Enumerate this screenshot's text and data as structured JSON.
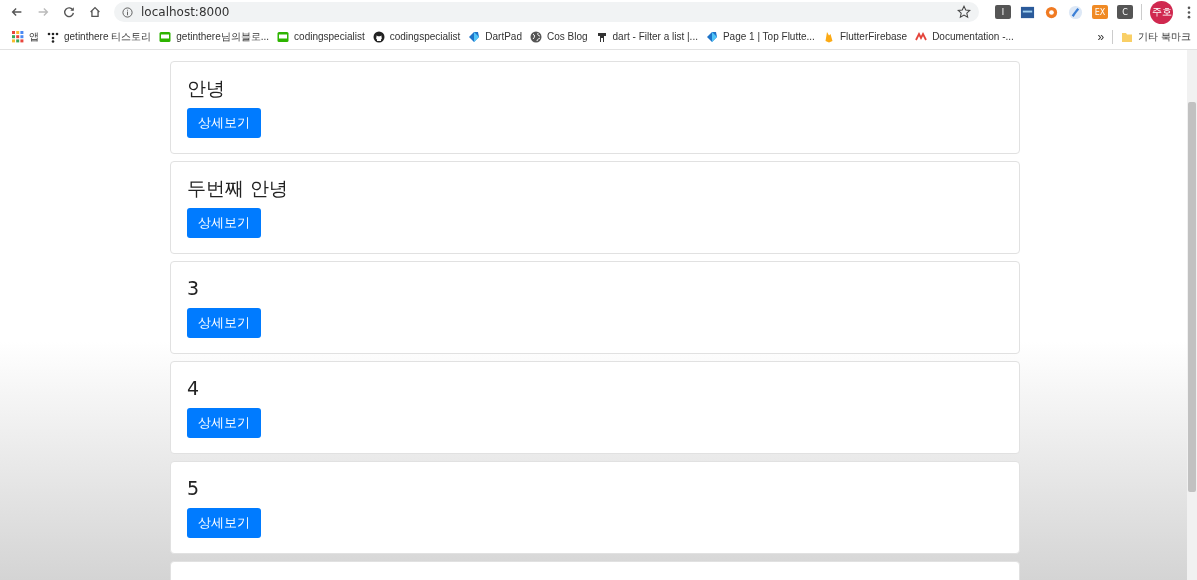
{
  "browser": {
    "url": "localhost:8000",
    "extensions": [
      {
        "kind": "letter",
        "label": "I",
        "color": "#555555"
      },
      {
        "kind": "bank",
        "color": "#2a5a9a"
      },
      {
        "kind": "ring",
        "color": "#f07a22"
      },
      {
        "kind": "swirl",
        "color": "#3b7fd6"
      },
      {
        "kind": "letter",
        "label": "EX",
        "color": "#f08a24"
      },
      {
        "kind": "letter",
        "label": "C",
        "color": "#555555"
      }
    ],
    "profile": "주호",
    "bookmarks": [
      {
        "kind": "apps",
        "label": "앱"
      },
      {
        "kind": "tistory",
        "label": "getinthere 티스토리"
      },
      {
        "kind": "blog",
        "label": "getinthere님의블로..."
      },
      {
        "kind": "blog",
        "label": "codingspecialist"
      },
      {
        "kind": "github",
        "label": "codingspecialist"
      },
      {
        "kind": "dart",
        "label": "DartPad"
      },
      {
        "kind": "globe",
        "label": "Cos Blog"
      },
      {
        "kind": "figure",
        "label": "dart - Filter a list |..."
      },
      {
        "kind": "dart",
        "label": "Page 1 | Top Flutte..."
      },
      {
        "kind": "firebase",
        "label": "FlutterFirebase"
      },
      {
        "kind": "mlogo",
        "label": "Documentation -..."
      }
    ],
    "more": "»",
    "other_bookmarks": "기타 북마크"
  },
  "posts": [
    {
      "title": "안녕",
      "button": "상세보기"
    },
    {
      "title": "두번째 안녕",
      "button": "상세보기"
    },
    {
      "title": "3",
      "button": "상세보기"
    },
    {
      "title": "4",
      "button": "상세보기"
    },
    {
      "title": "5",
      "button": "상세보기"
    }
  ]
}
